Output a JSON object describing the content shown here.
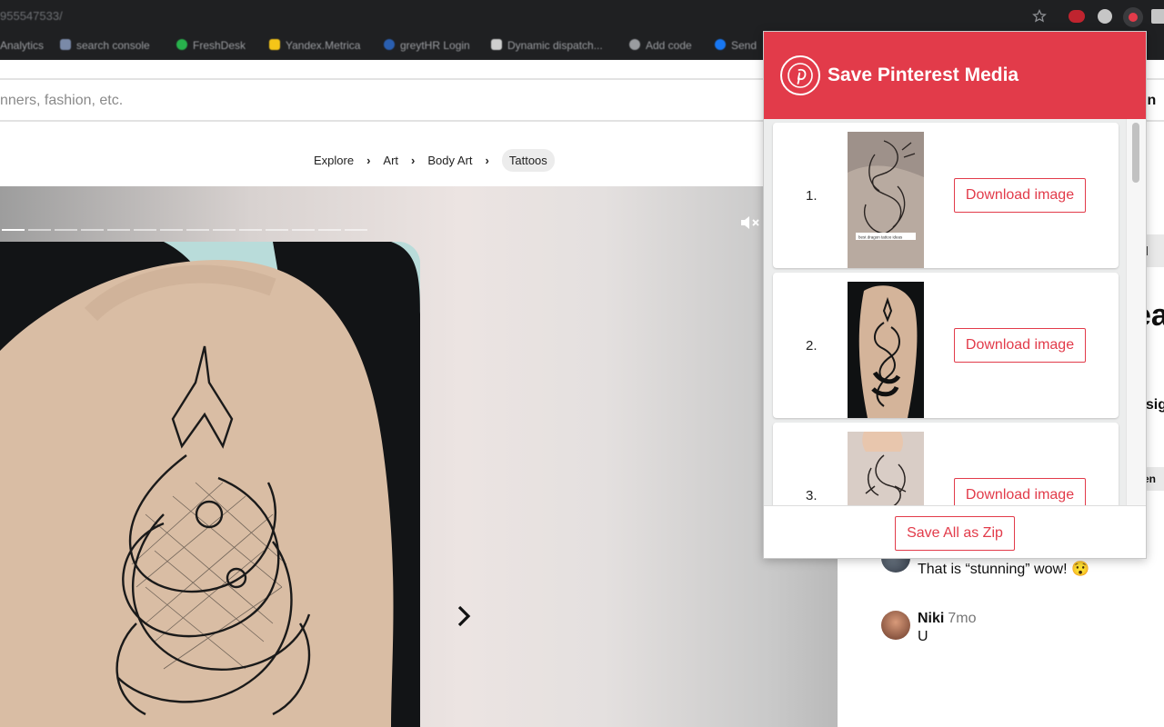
{
  "browser": {
    "url": "955547533/",
    "bookmarks": [
      {
        "label": "Analytics",
        "color": "#9a9ca0"
      },
      {
        "label": "search console",
        "color": "#7a8aa8"
      },
      {
        "label": "FreshDesk",
        "color": "#28b14c"
      },
      {
        "label": "Yandex.Metrica",
        "color": "#f5c518"
      },
      {
        "label": "greytHR Login",
        "color": "#2a5fb0"
      },
      {
        "label": "Dynamic dispatch...",
        "color": "#cfcfcf"
      },
      {
        "label": "Add code",
        "color": "#9a9ca0"
      },
      {
        "label": "Send",
        "color": "#1877f2"
      }
    ]
  },
  "page": {
    "search_placeholder": "nners, fashion, etc.",
    "breadcrumbs": [
      "Explore",
      "Art",
      "Body Art",
      "Tattoos"
    ],
    "right_edge": {
      "login": "in",
      "tab": "d",
      "title": "ea",
      "desc": "esig",
      "chip": "en"
    },
    "comments": [
      {
        "name": "",
        "time": "",
        "text": "That is “stunning” wow! 😯"
      },
      {
        "name": "Niki",
        "time": "7mo",
        "text": "U"
      }
    ]
  },
  "popup": {
    "title": "Save Pinterest Media",
    "brand_color": "#e23b4a",
    "items": [
      {
        "index": "1.",
        "button": "Download image",
        "thumb_caption": "best dragon tattoo ideas"
      },
      {
        "index": "2.",
        "button": "Download image"
      },
      {
        "index": "3.",
        "button": "Download image"
      }
    ],
    "zip_button": "Save All as Zip"
  }
}
